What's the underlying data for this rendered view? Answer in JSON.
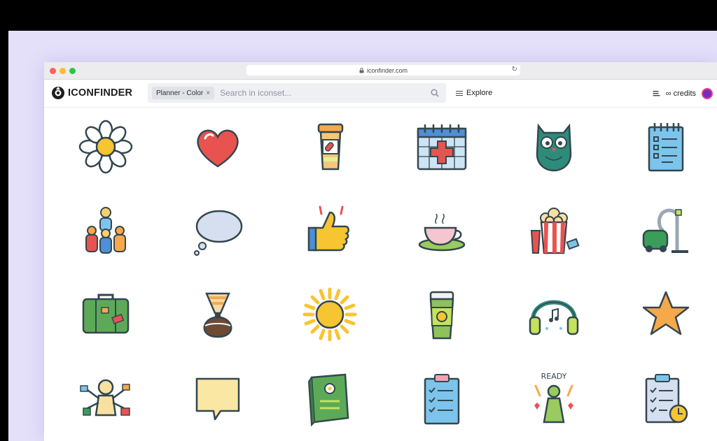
{
  "browser": {
    "url": "iconfinder.com"
  },
  "header": {
    "logo_text": "ICONFINDER",
    "search_chip": "Planner - Color",
    "chip_close": "×",
    "search_placeholder": "Search in iconset...",
    "explore_label": "Explore",
    "credits_label": "∞ credits"
  },
  "icons": [
    {
      "name": "flower-icon"
    },
    {
      "name": "heart-icon"
    },
    {
      "name": "pill-bottle-icon"
    },
    {
      "name": "medical-calendar-icon"
    },
    {
      "name": "owl-icon"
    },
    {
      "name": "notepad-checklist-icon"
    },
    {
      "name": "group-people-icon"
    },
    {
      "name": "speech-bubble-icon"
    },
    {
      "name": "thumbs-up-icon"
    },
    {
      "name": "tea-cup-icon"
    },
    {
      "name": "popcorn-icon"
    },
    {
      "name": "vacuum-cleaner-icon"
    },
    {
      "name": "suitcase-icon"
    },
    {
      "name": "coffee-maker-icon"
    },
    {
      "name": "sun-icon"
    },
    {
      "name": "coffee-cup-icon"
    },
    {
      "name": "headphones-icon"
    },
    {
      "name": "star-icon"
    },
    {
      "name": "multitasking-person-icon"
    },
    {
      "name": "note-bubble-icon"
    },
    {
      "name": "good-book-icon"
    },
    {
      "name": "clipboard-checklist-icon"
    },
    {
      "name": "ready-person-icon"
    },
    {
      "name": "clipboard-clock-icon"
    }
  ],
  "colors": {
    "accent_lavender": "#e4e0fa",
    "outline": "#33474f"
  }
}
